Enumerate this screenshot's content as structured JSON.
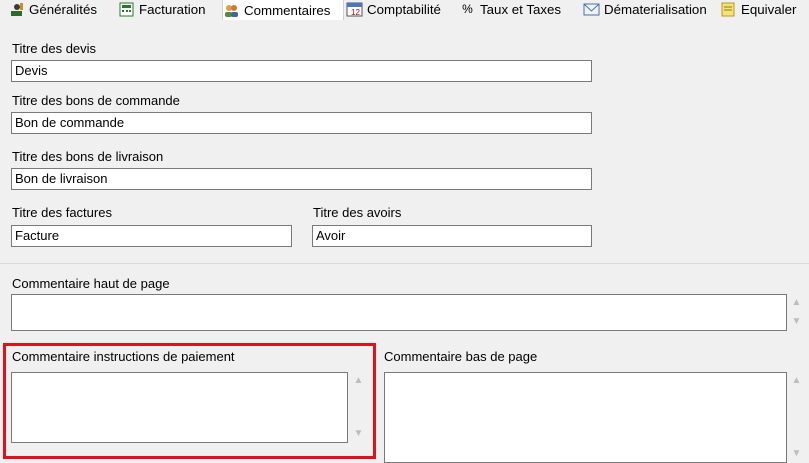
{
  "tabs": [
    {
      "label": "Généralités",
      "icon": "wrench-figure-icon"
    },
    {
      "label": "Facturation",
      "icon": "calculator-icon"
    },
    {
      "label": "Commentaires",
      "icon": "people-icon"
    },
    {
      "label": "Comptabilité",
      "icon": "calendar-icon",
      "icon_text": "12"
    },
    {
      "label": "Taux et Taxes",
      "icon": "percent-icon",
      "icon_text": "%"
    },
    {
      "label": "Dématerialisation",
      "icon": "envelope-icon"
    },
    {
      "label": "Equivaler",
      "icon": "note-icon"
    }
  ],
  "active_tab": "Commentaires",
  "form": {
    "devis_label": "Titre des devis",
    "devis_value": "Devis",
    "bons_commande_label": "Titre des bons de commande",
    "bons_commande_value": "Bon de commande",
    "bons_livraison_label": "Titre des bons de livraison",
    "bons_livraison_value": "Bon de livraison",
    "factures_label": "Titre des factures",
    "factures_value": "Facture",
    "avoirs_label": "Titre des avoirs",
    "avoirs_value": "Avoir",
    "haut_page_label": "Commentaire haut de page",
    "haut_page_value": "",
    "paiement_label": "Commentaire instructions de paiement",
    "paiement_value": "",
    "bas_page_label": "Commentaire bas de page",
    "bas_page_value": ""
  },
  "colors": {
    "highlight": "#e0101e"
  }
}
